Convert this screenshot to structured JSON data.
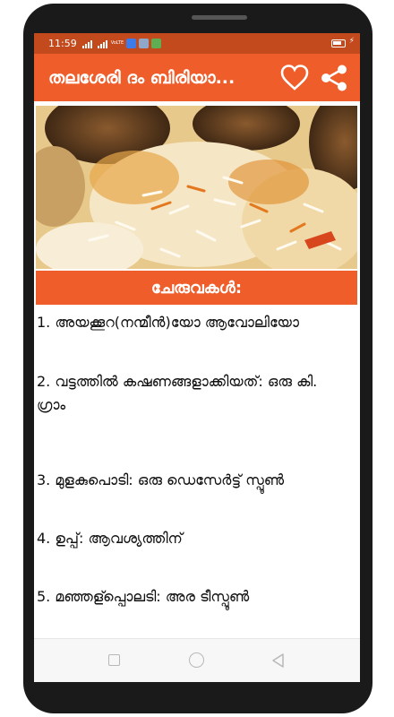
{
  "status_bar": {
    "time": "11:59",
    "network_label": "VoLTE",
    "accent_color": "#c24a1c"
  },
  "app_bar": {
    "title": "തലശേരി ദം ബിരിയാ...",
    "favorite_icon": "heart-outline-icon",
    "share_icon": "share-icon",
    "color": "#ef5d2a"
  },
  "recipe": {
    "image_alt": "biryani photo",
    "section_title": "ചേരുവകൾ:",
    "ingredients": [
      "1. അയക്കൂറ(നന്മീൻ)യോ ആവോലിയോ",
      "2. വട്ടത്തിൽ കഷണങ്ങളാക്കിയത്: ഒരു കി. ഗ്രാം",
      "3. മുളകുപൊടി: ഒരു ഡെസേർട്ട് സ്പൂൺ",
      "4. ഉപ്പ്: ആവശ്യത്തിന്",
      "5. മഞ്ഞള്പ്പൊലടി: അര ടീസ്പൂൺ"
    ]
  },
  "nav_bar": {
    "recents_icon": "square-icon",
    "home_icon": "circle-icon",
    "back_icon": "triangle-back-icon"
  }
}
